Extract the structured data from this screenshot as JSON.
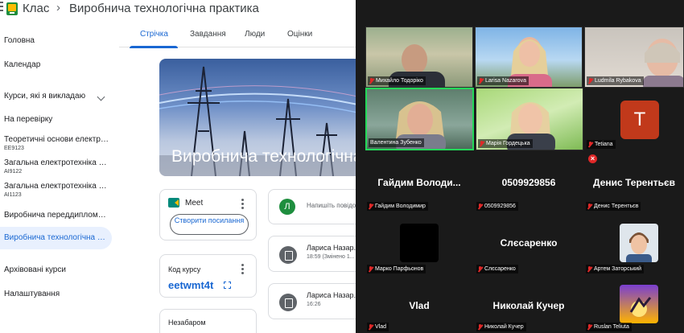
{
  "classroom": {
    "app_name": "Клас",
    "breadcrumb_separator": "›",
    "course_title": "Виробнича технологічна практика",
    "sidebar": {
      "home": "Головна",
      "calendar": "Календар",
      "teaching_header": "Курси, які я викладаю",
      "to_review": "На перевірку",
      "courses": [
        {
          "name": "Теоретичні основи електроте...",
          "code": "EE9123"
        },
        {
          "name": "Загальна електротехніка з ос...",
          "code": "AI9122"
        },
        {
          "name": "Загальна електротехніка з ос...",
          "code": "AI1123"
        },
        {
          "name": "Виробнича переддипломна п..."
        },
        {
          "name": "Виробнича технологічна пра..."
        }
      ],
      "archived": "Архівовані курси",
      "settings": "Налаштування"
    },
    "tabs": [
      "Стрічка",
      "Завдання",
      "Люди",
      "Оцінки"
    ],
    "active_tab": "Стрічка",
    "banner_title": "Виробнича технологічна практика",
    "meet": {
      "label": "Meet",
      "create_button": "Створити посилання"
    },
    "class_code": {
      "label": "Код курсу",
      "value": "eetwmt4t"
    },
    "upcoming": {
      "label": "Незабаром"
    },
    "announce": {
      "avatar_letter": "Л",
      "placeholder": "Напишіть повідомлення для курсу"
    },
    "posts": [
      {
        "author": "Лариса Назар...",
        "time": "18:59 (Змінено 1..."
      },
      {
        "author": "Лариса Назар...",
        "time": "16:26"
      }
    ]
  },
  "zoom": {
    "participants": [
      {
        "name": "Михайло Тодоріко"
      },
      {
        "name": "Larisa Nazarova"
      },
      {
        "name": "Ludmila Rybakova"
      },
      {
        "name": "Валентина Зубенко"
      },
      {
        "name": "Марія Гордецька"
      },
      {
        "name": "Tetiana",
        "avatar_letter": "T"
      },
      {
        "name": "Гайдим Володимир",
        "display": "Гайдим Володи..."
      },
      {
        "name": "0509929856",
        "display": "0509929856"
      },
      {
        "name": "Денис Терентьєв",
        "display": "Денис Терентьєв"
      },
      {
        "name": "Марко Парфьонов"
      },
      {
        "name": "Слєсаренко",
        "display": "Слєсаренко"
      },
      {
        "name": "Артем Заторський"
      },
      {
        "name": "Vlad",
        "display": "Vlad"
      },
      {
        "name": "Николай Кучер",
        "display": "Николай Кучер"
      },
      {
        "name": "Ruslan Teliuta"
      }
    ],
    "colors": {
      "speaking_border": "#23d959",
      "muted_icon": "#e02828",
      "tetiana_avatar": "#c1391b"
    }
  }
}
